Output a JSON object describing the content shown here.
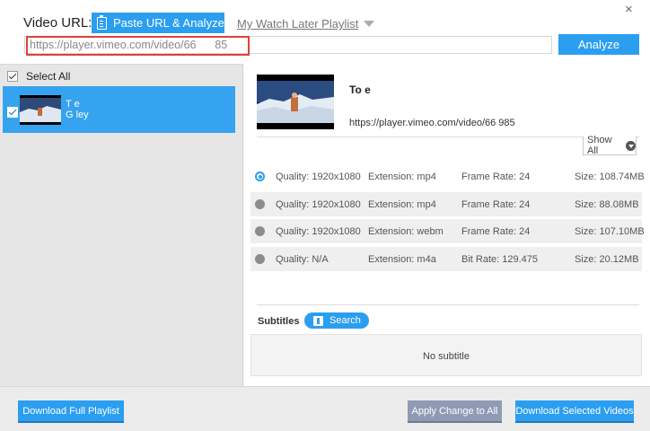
{
  "header": {
    "video_url_label": "Video URL:",
    "paste_button": "Paste URL & Analyze",
    "watch_later_link": "My Watch Later Playlist",
    "close_glyph": "×",
    "url_value": "https://player.vimeo.com/video/66      85",
    "analyze_button": "Analyze"
  },
  "sidebar": {
    "select_all_label": "Select All",
    "items": [
      {
        "title": "T     e",
        "subtitle": "G         ley",
        "checked": true
      }
    ]
  },
  "detail": {
    "title": "To     e",
    "url": "https://player.vimeo.com/video/66     985",
    "show_all_label": "Show All"
  },
  "qualities": [
    {
      "quality": "Quality: 1920x1080",
      "extension": "Extension: mp4",
      "rate": "Frame Rate: 24",
      "size": "Size: 108.74MB",
      "selected": true
    },
    {
      "quality": "Quality: 1920x1080",
      "extension": "Extension: mp4",
      "rate": "Frame Rate: 24",
      "size": "Size: 88.08MB",
      "selected": false
    },
    {
      "quality": "Quality: 1920x1080",
      "extension": "Extension: webm",
      "rate": "Frame Rate: 24",
      "size": "Size: 107.10MB",
      "selected": false
    },
    {
      "quality": "Quality: N/A",
      "extension": "Extension: m4a",
      "rate": "Bit Rate: 129.475",
      "size": "Size: 20.12MB",
      "selected": false
    }
  ],
  "subtitles": {
    "label": "Subtitles",
    "search_button": "Search",
    "empty_text": "No subtitle"
  },
  "footer": {
    "download_playlist": "Download Full Playlist",
    "apply_change": "Apply Change to All",
    "download_selected": "Download Selected Videos"
  },
  "colors": {
    "accent": "#2c9ef0",
    "selection": "#36a3f0",
    "highlight_border": "#e0413a",
    "disabled_button": "#8f9bb4"
  },
  "icons": {
    "paste_button": "clipboard-icon",
    "watch_later": "dropdown-triangle-icon",
    "show_all": "chevron-down-circle-icon",
    "search_button": "subtitle-search-icon"
  }
}
